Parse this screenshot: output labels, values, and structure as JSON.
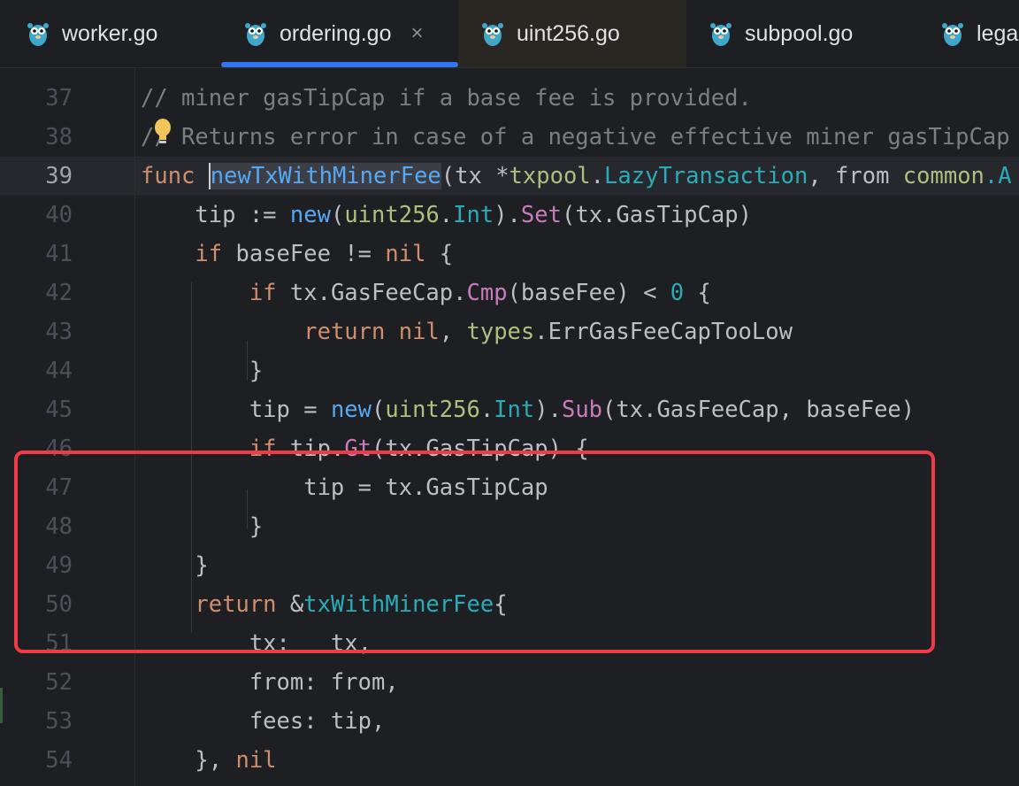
{
  "tabs": [
    {
      "label": "worker.go",
      "icon": "gopher-icon",
      "active": false
    },
    {
      "label": "ordering.go",
      "icon": "gopher-icon",
      "active": true,
      "close": "×"
    },
    {
      "label": "uint256.go",
      "icon": "gopher-icon",
      "active": false
    },
    {
      "label": "subpool.go",
      "icon": "gopher-icon",
      "active": false
    },
    {
      "label": "lega",
      "icon": "gopher-icon",
      "active": false
    }
  ],
  "current_line": 39,
  "highlight_box_lines": [
    45,
    49
  ],
  "colors": {
    "background": "#1e1f22",
    "keyword": "#cf8e6d",
    "function": "#56a8f5",
    "type": "#2aacb8",
    "package": "#afbf7e",
    "method": "#c77dbb",
    "comment": "#7a7e85",
    "text": "#bcbec4",
    "active_tab_underline": "#3574f0",
    "highlight_box": "#f03a47"
  },
  "lines": [
    {
      "n": "37",
      "tokens": [
        {
          "t": "// miner gasTipCap if a base fee is provided.",
          "c": "cmt"
        }
      ]
    },
    {
      "n": "38",
      "tokens": [
        {
          "t": "// Returns error in case of a negative effective miner gasTipCap",
          "c": "cmt"
        }
      ]
    },
    {
      "n": "39",
      "tokens": [
        {
          "t": "func",
          "c": "kw"
        },
        {
          "t": " ",
          "c": "plain"
        },
        {
          "t": "newTxWithMinerFee",
          "c": "fn decl-highlight"
        },
        {
          "t": "(tx *",
          "c": "plain"
        },
        {
          "t": "txpool",
          "c": "pkg"
        },
        {
          "t": ".",
          "c": "plain"
        },
        {
          "t": "LazyTransaction",
          "c": "ty"
        },
        {
          "t": ", from ",
          "c": "plain"
        },
        {
          "t": "common",
          "c": "pkg"
        },
        {
          "t": ".A",
          "c": "ty"
        }
      ]
    },
    {
      "n": "40",
      "tokens": [
        {
          "t": "    tip := ",
          "c": "plain"
        },
        {
          "t": "new",
          "c": "fn"
        },
        {
          "t": "(",
          "c": "plain"
        },
        {
          "t": "uint256",
          "c": "pkg"
        },
        {
          "t": ".",
          "c": "plain"
        },
        {
          "t": "Int",
          "c": "ty"
        },
        {
          "t": ").",
          "c": "plain"
        },
        {
          "t": "Set",
          "c": "mt"
        },
        {
          "t": "(tx.GasTipCap)",
          "c": "plain"
        }
      ]
    },
    {
      "n": "41",
      "tokens": [
        {
          "t": "    ",
          "c": "plain"
        },
        {
          "t": "if",
          "c": "kw"
        },
        {
          "t": " baseFee != ",
          "c": "plain"
        },
        {
          "t": "nil",
          "c": "kw"
        },
        {
          "t": " {",
          "c": "plain"
        }
      ]
    },
    {
      "n": "42",
      "tokens": [
        {
          "t": "        ",
          "c": "plain"
        },
        {
          "t": "if",
          "c": "kw"
        },
        {
          "t": " tx.GasFeeCap.",
          "c": "plain"
        },
        {
          "t": "Cmp",
          "c": "mt"
        },
        {
          "t": "(baseFee) < ",
          "c": "plain"
        },
        {
          "t": "0",
          "c": "num"
        },
        {
          "t": " {",
          "c": "plain"
        }
      ]
    },
    {
      "n": "43",
      "tokens": [
        {
          "t": "            ",
          "c": "plain"
        },
        {
          "t": "return",
          "c": "kw"
        },
        {
          "t": " ",
          "c": "plain"
        },
        {
          "t": "nil",
          "c": "kw"
        },
        {
          "t": ", ",
          "c": "plain"
        },
        {
          "t": "types",
          "c": "pkg"
        },
        {
          "t": ".ErrGasFeeCapTooLow",
          "c": "plain"
        }
      ]
    },
    {
      "n": "44",
      "tokens": [
        {
          "t": "        }",
          "c": "plain"
        }
      ]
    },
    {
      "n": "45",
      "tokens": [
        {
          "t": "        tip = ",
          "c": "plain"
        },
        {
          "t": "new",
          "c": "fn"
        },
        {
          "t": "(",
          "c": "plain"
        },
        {
          "t": "uint256",
          "c": "pkg"
        },
        {
          "t": ".",
          "c": "plain"
        },
        {
          "t": "Int",
          "c": "ty"
        },
        {
          "t": ").",
          "c": "plain"
        },
        {
          "t": "Sub",
          "c": "mt"
        },
        {
          "t": "(tx.GasFeeCap, baseFee)",
          "c": "plain"
        }
      ]
    },
    {
      "n": "46",
      "tokens": [
        {
          "t": "        ",
          "c": "plain"
        },
        {
          "t": "if",
          "c": "kw"
        },
        {
          "t": " tip.",
          "c": "plain"
        },
        {
          "t": "Gt",
          "c": "mt"
        },
        {
          "t": "(tx.GasTipCap) {",
          "c": "plain"
        }
      ]
    },
    {
      "n": "47",
      "tokens": [
        {
          "t": "            tip = tx.GasTipCap",
          "c": "plain"
        }
      ]
    },
    {
      "n": "48",
      "tokens": [
        {
          "t": "        }",
          "c": "plain"
        }
      ]
    },
    {
      "n": "49",
      "tokens": [
        {
          "t": "    }",
          "c": "plain"
        }
      ]
    },
    {
      "n": "50",
      "tokens": [
        {
          "t": "    ",
          "c": "plain"
        },
        {
          "t": "return",
          "c": "kw"
        },
        {
          "t": " &",
          "c": "plain"
        },
        {
          "t": "txWithMinerFee",
          "c": "ty"
        },
        {
          "t": "{",
          "c": "plain"
        }
      ]
    },
    {
      "n": "51",
      "tokens": [
        {
          "t": "        tx:   tx,",
          "c": "plain"
        }
      ]
    },
    {
      "n": "52",
      "tokens": [
        {
          "t": "        from: from,",
          "c": "plain"
        }
      ]
    },
    {
      "n": "53",
      "tokens": [
        {
          "t": "        fees: tip,",
          "c": "plain"
        }
      ]
    },
    {
      "n": "54",
      "tokens": [
        {
          "t": "    }, ",
          "c": "plain"
        },
        {
          "t": "nil",
          "c": "kw"
        }
      ]
    }
  ]
}
